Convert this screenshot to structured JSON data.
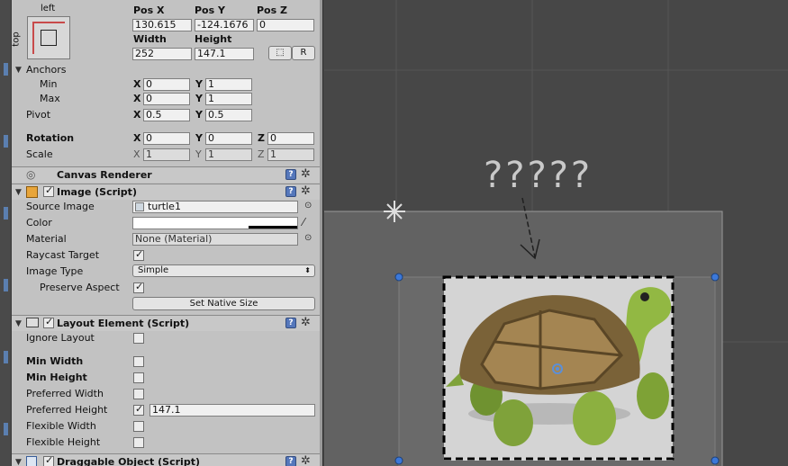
{
  "anchor_preset": {
    "side_label": "left",
    "vertical_label": "top"
  },
  "transform": {
    "headers": {
      "pos_x": "Pos X",
      "pos_y": "Pos Y",
      "pos_z": "Pos Z",
      "width": "Width",
      "height": "Height"
    },
    "pos_x": "130.615",
    "pos_y": "-124.1676",
    "pos_z": "0",
    "width": "252",
    "height": "147.1",
    "raw_button": "R",
    "anchors_label": "Anchors",
    "min_label": "Min",
    "max_label": "Max",
    "min": {
      "x": "0",
      "y": "1"
    },
    "max": {
      "x": "0",
      "y": "1"
    },
    "pivot_label": "Pivot",
    "pivot": {
      "x": "0.5",
      "y": "0.5"
    },
    "rotation_label": "Rotation",
    "rotation": {
      "x": "0",
      "y": "0",
      "z": "0"
    },
    "scale_label": "Scale",
    "scale": {
      "x": "1",
      "y": "1",
      "z": "1"
    },
    "axes": {
      "x": "X",
      "y": "Y",
      "z": "Z"
    }
  },
  "canvas_renderer": {
    "title": "Canvas Renderer"
  },
  "image_script": {
    "title": "Image (Script)",
    "source_image_label": "Source Image",
    "source_image_value": "turtle1",
    "color_label": "Color",
    "material_label": "Material",
    "material_value": "None (Material)",
    "raycast_label": "Raycast Target",
    "raycast_checked": true,
    "image_type_label": "Image Type",
    "image_type_value": "Simple",
    "preserve_label": "Preserve Aspect",
    "preserve_checked": true,
    "set_native_label": "Set Native Size"
  },
  "layout_element": {
    "title": "Layout Element (Script)",
    "ignore_layout_label": "Ignore Layout",
    "min_width_label": "Min Width",
    "min_height_label": "Min Height",
    "pref_width_label": "Preferred Width",
    "pref_height_label": "Preferred Height",
    "pref_height_value": "147.1",
    "flex_width_label": "Flexible Width",
    "flex_height_label": "Flexible Height"
  },
  "draggable": {
    "title": "Draggable Object (Script)"
  },
  "scene": {
    "annotation": "?????",
    "background": "#474747",
    "selection_color": "#5b8fd8"
  }
}
